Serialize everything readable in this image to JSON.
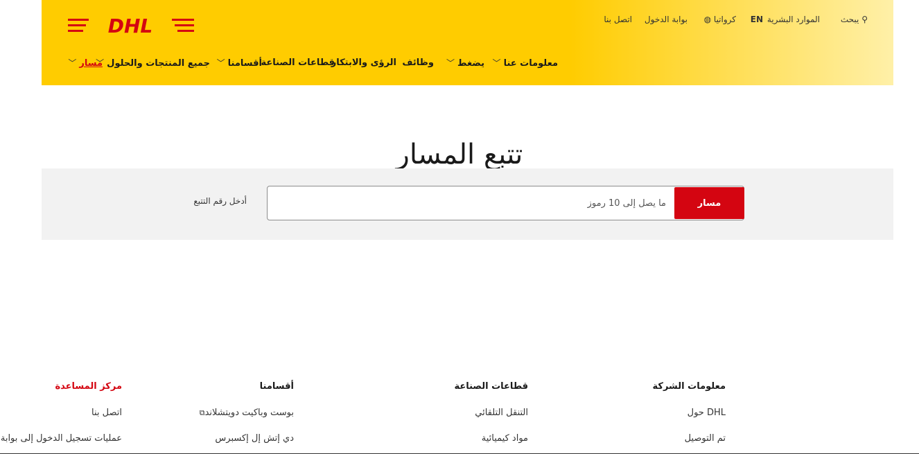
{
  "header": {
    "brand": "DHL",
    "brand_color": "#d40511",
    "accent_color": "#ffcc00",
    "utility": {
      "search_label": "يبحث",
      "search_icon": "search-icon",
      "hr_label": "الموارد البشرية",
      "lang_label": "EN",
      "country_label": "كرواتيا",
      "globe_icon": "globe-icon",
      "portal_label": "بوابة الدخول",
      "contact_label": "اتصل بنا"
    },
    "nav": {
      "about": "معلومات عنا",
      "press": "يضغط",
      "jobs": "وظائف",
      "insights": "الرؤى والابتكار",
      "industries": "قطاعات الصناعة",
      "divisions": "أقسامنا",
      "products": "جميع المنتجات والحلول",
      "track": "مسار"
    }
  },
  "main": {
    "title": "تتبع المسار",
    "track_label": "أدخل رقم التتبع",
    "track_placeholder": "ما يصل إلى 10 رموز",
    "track_value": "",
    "track_button": "مسار"
  },
  "footer": {
    "company": {
      "title": "معلومات الشركة",
      "links": [
        "DHL حول",
        "تم التوصيل"
      ]
    },
    "industries": {
      "title": "قطاعات الصناعة",
      "links": [
        "التنقل التلقائي",
        "مواد كيميائية"
      ]
    },
    "divisions": {
      "title": "أقسامنا",
      "links": [
        "بوست وباكيت دويتشلاند",
        "دي إتش إل إكسبرس"
      ]
    },
    "help": {
      "title": "مركز المساعدة",
      "links": [
        "اتصل بنا",
        "عمليات تسجيل الدخول إلى بوابة العملاء"
      ]
    }
  }
}
